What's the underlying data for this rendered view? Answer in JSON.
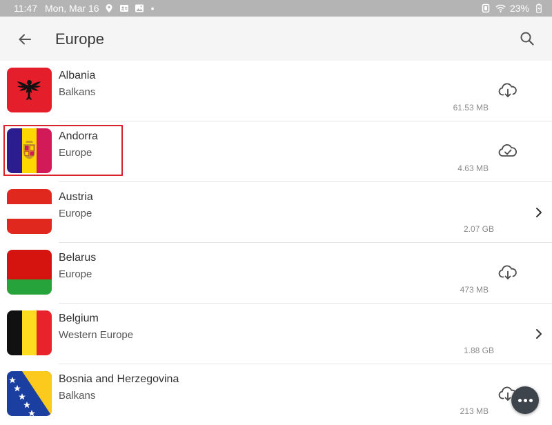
{
  "status_bar": {
    "time": "11:47",
    "date": "Mon, Mar 16",
    "dot": "•",
    "battery_text": "23%"
  },
  "app_bar": {
    "title": "Europe",
    "back_icon": "arrow-left-icon",
    "search_icon": "search-icon"
  },
  "countries": [
    {
      "name": "Albania",
      "region": "Balkans",
      "size": "61.53 MB",
      "action": "cloud-download-icon"
    },
    {
      "name": "Andorra",
      "region": "Europe",
      "size": "4.63 MB",
      "action": "cloud-check-icon"
    },
    {
      "name": "Austria",
      "region": "Europe",
      "size": "2.07 GB",
      "action": "chevron-right-icon"
    },
    {
      "name": "Belarus",
      "region": "Europe",
      "size": "473 MB",
      "action": "cloud-download-icon"
    },
    {
      "name": "Belgium",
      "region": "Western Europe",
      "size": "1.88 GB",
      "action": "chevron-right-icon"
    },
    {
      "name": "Bosnia and Herzegovina",
      "region": "Balkans",
      "size": "213 MB",
      "action": "cloud-download-icon"
    }
  ],
  "colors": {
    "status_bar_bg": "#b4b4b4",
    "app_bar_bg": "#f5f5f5",
    "highlight": "#d9232a",
    "fab_bg": "#3d444b"
  }
}
